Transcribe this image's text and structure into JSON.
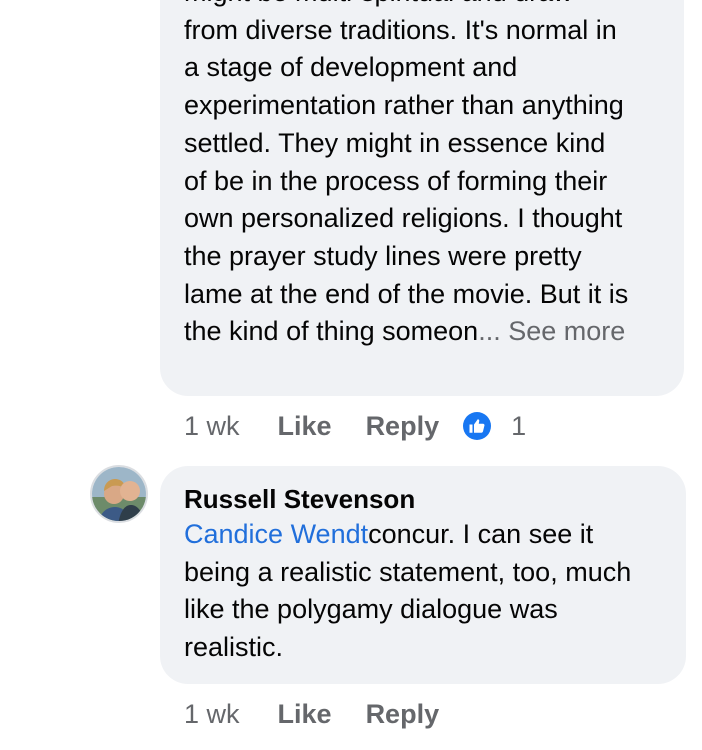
{
  "comment1": {
    "lines": [
      "might be multi-spiritual and draw",
      "from diverse traditions. It's normal in",
      "a stage of development and",
      "experimentation rather than anything",
      "settled. They might in essence kind",
      "of be in the process of forming their",
      "own personalized religions. I thought",
      "the prayer study lines were pretty",
      "lame at the end of the movie. But it is"
    ],
    "last_line": "the kind of thing someon",
    "ellipsis": "...",
    "see_more": " See more",
    "time": "1 wk",
    "like_label": "Like",
    "reply_label": "Reply",
    "reaction_count": "1"
  },
  "comment2": {
    "author": "Russell Stevenson",
    "mention": "Candice Wendt",
    "text": "concur. I can see it being a realistic statement, too, much like the polygamy dialogue was realistic.",
    "time": "1 wk",
    "like_label": "Like",
    "reply_label": "Reply"
  },
  "colors": {
    "bubble": "#f0f2f5",
    "mention": "#216fdb",
    "muted": "#65676b",
    "like_badge": "#1877f2"
  },
  "icons": {
    "reaction": "thumbs-up-icon",
    "avatar": "profile-photo"
  }
}
